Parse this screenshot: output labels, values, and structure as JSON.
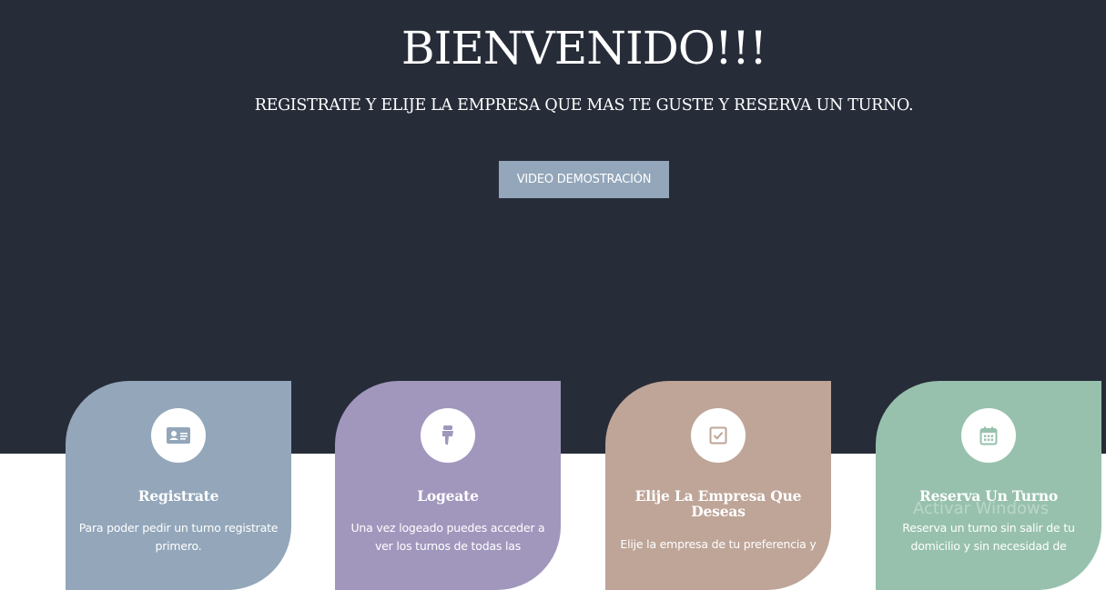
{
  "hero": {
    "title": "BIENVENIDO!!!",
    "subtitle": "REGISTRATE Y ELIJE LA EMPRESA QUE MAS TE GUSTE Y RESERVA UN TURNO.",
    "video_button": "VIDEO DEMOSTRACIÓN",
    "background": "#272c39",
    "button_color": "#93a6ba"
  },
  "cards": [
    {
      "icon": "id-card-icon",
      "color": "#93a6ba",
      "title": "Registrate",
      "description": "Para poder pedir un turno registrate primero."
    },
    {
      "icon": "thumbs-down-icon",
      "color": "#a197bd",
      "title": "Logeate",
      "description": "Una vez logeado puedes acceder a ver los turnos de todas las"
    },
    {
      "icon": "checkbox-icon",
      "color": "#bea598",
      "title": "Elije La Empresa Que Deseas",
      "description": "Elije la empresa de tu preferencia y"
    },
    {
      "icon": "calendar-icon",
      "color": "#97c1ad",
      "title": "Reserva Un Turno",
      "description": "Reserva un turno sin salir de tu domicilio y sin necesidad de"
    }
  ],
  "watermark": "Activar Windows"
}
